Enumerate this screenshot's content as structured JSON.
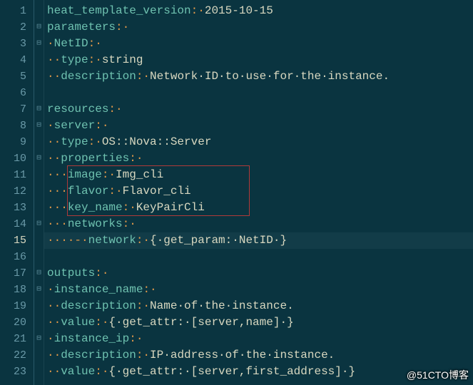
{
  "watermark": "@51CTO博客",
  "gutter": {
    "lines": [
      "1",
      "2",
      "3",
      "4",
      "5",
      "6",
      "7",
      "8",
      "9",
      "10",
      "11",
      "12",
      "13",
      "14",
      "15",
      "16",
      "17",
      "18",
      "19",
      "20",
      "21",
      "22",
      "23"
    ],
    "active": 15
  },
  "fold_markers": {
    "2": "⊟",
    "3": "⊟",
    "7": "⊟",
    "8": "⊟",
    "10": "⊟",
    "14": "⊟",
    "17": "⊟",
    "18": "⊟",
    "21": "⊟"
  },
  "highlight_box": {
    "top_line": 11,
    "bottom_line": 13,
    "left_ch": 3,
    "right_ch": 28
  },
  "yaml_source": {
    "heat_template_version": "2015-10-15",
    "parameters": {
      "NetID": {
        "type": "string",
        "description": "Network ID to use for the instance."
      }
    },
    "resources": {
      "server": {
        "type": "OS::Nova::Server",
        "properties": {
          "image": "Img_cli",
          "flavor": "Flavor_cli",
          "key_name": "KeyPairCli",
          "networks": [
            {
              "network": {
                "get_param": "NetID"
              }
            }
          ]
        }
      }
    },
    "outputs": {
      "instance_name": {
        "description": "Name of the instance.",
        "value": {
          "get_attr": [
            "server",
            "name"
          ]
        }
      },
      "instance_ip": {
        "description": "IP address of the instance.",
        "value": {
          "get_attr": [
            "server",
            "first_address"
          ]
        }
      }
    }
  },
  "lines": {
    "l1": {
      "pre": "",
      "key": "heat_template_version",
      "sep": ":·",
      "val": "2015-10-15"
    },
    "l2": {
      "pre": "",
      "key": "parameters",
      "sep": ":·",
      "val": ""
    },
    "l3": {
      "pre": "·",
      "key": "NetID",
      "sep": ":·",
      "val": ""
    },
    "l4": {
      "pre": "··",
      "key": "type",
      "sep": ":·",
      "val": "string"
    },
    "l5": {
      "pre": "··",
      "key": "description",
      "sep": ":·",
      "val": "Network·ID·to·use·for·the·instance."
    },
    "l6": {
      "pre": "",
      "key": "",
      "sep": "",
      "val": ""
    },
    "l7": {
      "pre": "",
      "key": "resources",
      "sep": ":·",
      "val": ""
    },
    "l8": {
      "pre": "·",
      "key": "server",
      "sep": ":·",
      "val": ""
    },
    "l9": {
      "pre": "··",
      "key": "type",
      "sep": ":·",
      "val": "OS::Nova::Server"
    },
    "l10": {
      "pre": "··",
      "key": "properties",
      "sep": ":·",
      "val": ""
    },
    "l11": {
      "pre": "···",
      "key": "image",
      "sep": ":·",
      "val": "Img_cli"
    },
    "l12": {
      "pre": "···",
      "key": "flavor",
      "sep": ":·",
      "val": "Flavor_cli"
    },
    "l13": {
      "pre": "···",
      "key": "key_name",
      "sep": ":·",
      "val": "KeyPairCli"
    },
    "l14": {
      "pre": "···",
      "key": "networks",
      "sep": ":·",
      "val": ""
    },
    "l15": {
      "pre": "····",
      "dash": "-·",
      "key": "network",
      "sep": ":·",
      "val": "{·get_param:·NetID·}"
    },
    "l16": {
      "pre": "",
      "key": "",
      "sep": "",
      "val": ""
    },
    "l17": {
      "pre": "",
      "key": "outputs",
      "sep": ":·",
      "val": ""
    },
    "l18": {
      "pre": "·",
      "key": "instance_name",
      "sep": ":·",
      "val": ""
    },
    "l19": {
      "pre": "··",
      "key": "description",
      "sep": ":·",
      "val": "Name·of·the·instance."
    },
    "l20": {
      "pre": "··",
      "key": "value",
      "sep": ":·",
      "val": "{·get_attr:·[server,name]·}"
    },
    "l21": {
      "pre": "·",
      "key": "instance_ip",
      "sep": ":·",
      "val": ""
    },
    "l22": {
      "pre": "··",
      "key": "description",
      "sep": ":·",
      "val": "IP·address·of·the·instance."
    },
    "l23": {
      "pre": "··",
      "key": "value",
      "sep": ":·",
      "val": "{·get_attr:·[server,first_address]·}"
    }
  }
}
